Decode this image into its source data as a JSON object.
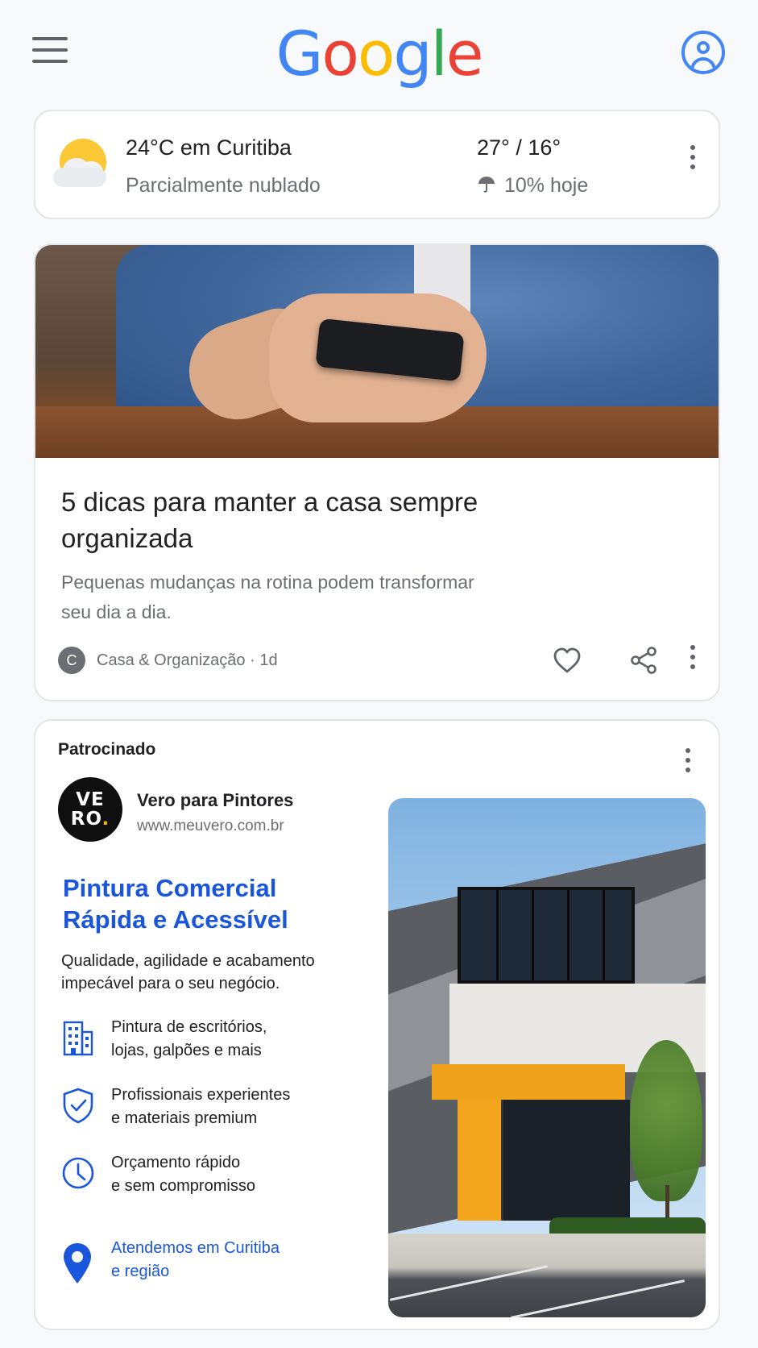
{
  "header": {
    "logo_letters": [
      {
        "char": "G",
        "color": "#4285F4"
      },
      {
        "char": "o",
        "color": "#EA4335"
      },
      {
        "char": "o",
        "color": "#FBBC05"
      },
      {
        "char": "g",
        "color": "#4285F4"
      },
      {
        "char": "l",
        "color": "#34A853"
      },
      {
        "char": "e",
        "color": "#EA4335"
      }
    ],
    "menu_icon": "hamburger-menu-icon",
    "account_icon": "account-circle-icon"
  },
  "weather": {
    "icon": "partly-cloudy-icon",
    "city_temp": "24°C em Curitiba",
    "condition": "Parcialmente nublado",
    "range": "27° / 16°",
    "rain_icon": "umbrella-icon",
    "rain": "10% hoje"
  },
  "article": {
    "image": "hand-holding-phone-photo",
    "title": "5 dicas para manter a casa sempre organizada",
    "description": "Pequenas mudanças na rotina podem transformar seu dia a dia.",
    "source_initial": "C",
    "source": "Casa & Organização · 1d",
    "like_icon": "heart-icon",
    "share_icon": "share-icon"
  },
  "ad": {
    "label": "Patrocinado",
    "logo_line1": "VE",
    "logo_line2": "RO",
    "logo_dot": ".",
    "advertiser": "Vero para Pintores",
    "url": "www.meuvero.com.br",
    "headline": "Pintura Comercial Rápida e Acessível",
    "body": "Qualidade, agilidade e acabamento impecável para o seu negócio.",
    "features": [
      {
        "icon": "building-icon",
        "text_line1": "Pintura de escritórios,",
        "text_line2": "lojas, galpões e mais"
      },
      {
        "icon": "shield-check-icon",
        "text_line1": "Profissionais experientes",
        "text_line2": "e materiais premium"
      },
      {
        "icon": "clock-icon",
        "text_line1": "Orçamento rápido",
        "text_line2": "e sem compromisso"
      }
    ],
    "location_icon": "map-pin-icon",
    "location_line1": "Atendemos em Curitiba",
    "location_line2": "e região",
    "image": "commercial-building-photo",
    "accent_color": "#1A56DB"
  }
}
